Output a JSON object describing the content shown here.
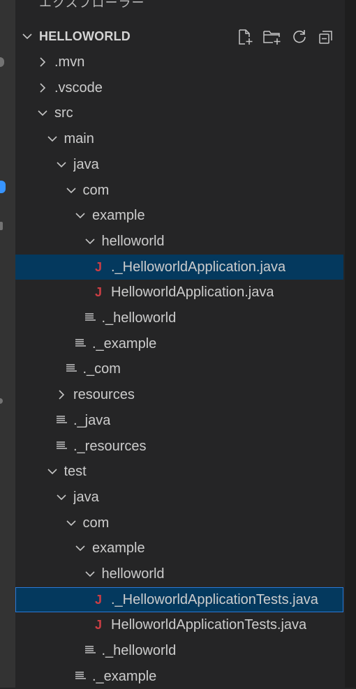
{
  "window": {
    "panel_title": "エクスプローラー",
    "more_actions_icon": "ellipsis-icon"
  },
  "colors": {
    "sidebar_bg": "#252526",
    "activity_bar_bg": "#333333",
    "selection_bg": "#04395e",
    "focus_border": "#2b79d6",
    "java_icon": "#cc3e44",
    "text": "#cccccc"
  },
  "explorer": {
    "root_label": "HELLOWORLD",
    "actions": [
      {
        "name": "new-file-icon",
        "label": "New File"
      },
      {
        "name": "new-folder-icon",
        "label": "New Folder"
      },
      {
        "name": "refresh-icon",
        "label": "Refresh Explorer"
      },
      {
        "name": "collapse-all-icon",
        "label": "Collapse Folders in Explorer"
      }
    ],
    "tree": [
      {
        "label": ".mvn",
        "type": "folder",
        "expanded": false,
        "depth": 0
      },
      {
        "label": ".vscode",
        "type": "folder",
        "expanded": false,
        "depth": 0
      },
      {
        "label": "src",
        "type": "folder",
        "expanded": true,
        "depth": 0
      },
      {
        "label": "main",
        "type": "folder",
        "expanded": true,
        "depth": 1
      },
      {
        "label": "java",
        "type": "folder",
        "expanded": true,
        "depth": 2
      },
      {
        "label": "com",
        "type": "folder",
        "expanded": true,
        "depth": 3
      },
      {
        "label": "example",
        "type": "folder",
        "expanded": true,
        "depth": 4
      },
      {
        "label": "helloworld",
        "type": "folder",
        "expanded": true,
        "depth": 5
      },
      {
        "label": "._HelloworldApplication.java",
        "type": "java",
        "depth": 6,
        "selected": true
      },
      {
        "label": "HelloworldApplication.java",
        "type": "java",
        "depth": 6
      },
      {
        "label": "._helloworld",
        "type": "text",
        "depth": 5
      },
      {
        "label": "._example",
        "type": "text",
        "depth": 4
      },
      {
        "label": "._com",
        "type": "text",
        "depth": 3
      },
      {
        "label": "resources",
        "type": "folder",
        "expanded": false,
        "depth": 2
      },
      {
        "label": "._java",
        "type": "text",
        "depth": 2
      },
      {
        "label": "._resources",
        "type": "text",
        "depth": 2
      },
      {
        "label": "test",
        "type": "folder",
        "expanded": true,
        "depth": 1
      },
      {
        "label": "java",
        "type": "folder",
        "expanded": true,
        "depth": 2
      },
      {
        "label": "com",
        "type": "folder",
        "expanded": true,
        "depth": 3
      },
      {
        "label": "example",
        "type": "folder",
        "expanded": true,
        "depth": 4
      },
      {
        "label": "helloworld",
        "type": "folder",
        "expanded": true,
        "depth": 5
      },
      {
        "label": "._HelloworldApplicationTests.java",
        "type": "java",
        "depth": 6,
        "focused": true
      },
      {
        "label": "HelloworldApplicationTests.java",
        "type": "java",
        "depth": 6
      },
      {
        "label": "._helloworld",
        "type": "text",
        "depth": 5
      },
      {
        "label": "._example",
        "type": "text",
        "depth": 4
      }
    ],
    "java_icon_glyph": "J"
  }
}
